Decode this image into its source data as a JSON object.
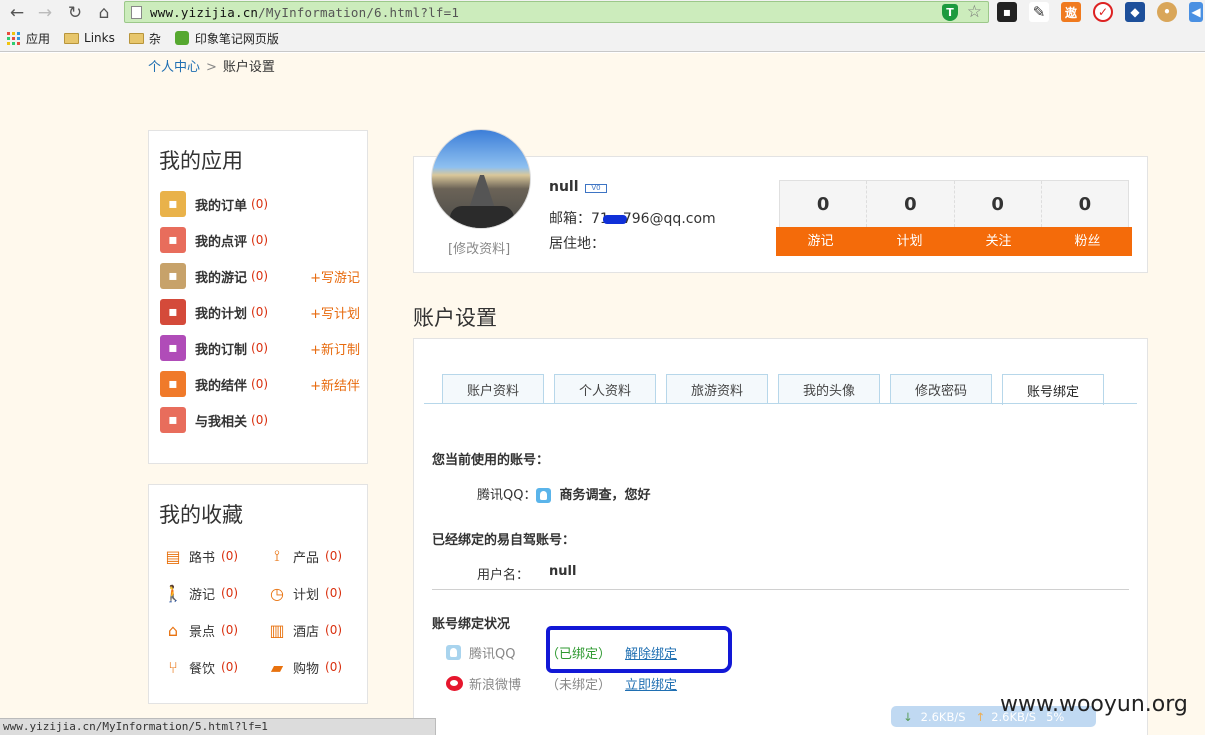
{
  "browser": {
    "url_host": "www.yizijia.cn",
    "url_path": "/MyInformation/6.html?lf=1",
    "bookmarks": [
      {
        "label": "应用"
      },
      {
        "label": "Links"
      },
      {
        "label": "杂"
      },
      {
        "label": "印象笔记网页版"
      }
    ],
    "status_url": "www.yizijia.cn/MyInformation/5.html?lf=1"
  },
  "breadcrumb": {
    "home": "个人中心",
    "sep": ">",
    "current": "账户设置"
  },
  "apps": {
    "title": "我的应用",
    "items": [
      {
        "label": "我的订单",
        "count": "(0)",
        "action": "",
        "icon": "order-icon",
        "color": "#e9b24a"
      },
      {
        "label": "我的点评",
        "count": "(0)",
        "action": "",
        "icon": "review-icon",
        "color": "#e86d5c"
      },
      {
        "label": "我的游记",
        "count": "(0)",
        "action": "+写游记",
        "icon": "travelnote-icon",
        "color": "#c7a26a"
      },
      {
        "label": "我的计划",
        "count": "(0)",
        "action": "+写计划",
        "icon": "clock-icon",
        "color": "#d44a3a"
      },
      {
        "label": "我的订制",
        "count": "(0)",
        "action": "+新订制",
        "icon": "custom-icon",
        "color": "#b04cb8"
      },
      {
        "label": "我的结伴",
        "count": "(0)",
        "action": "+新结伴",
        "icon": "group-icon",
        "color": "#f07a2a"
      },
      {
        "label": "与我相关",
        "count": "(0)",
        "action": "",
        "icon": "related-icon",
        "color": "#e86d5c"
      }
    ]
  },
  "favorites": {
    "title": "我的收藏",
    "items": [
      {
        "label": "路书",
        "count": "(0)",
        "icon": "roadbook-icon",
        "glyph": "▤"
      },
      {
        "label": "产品",
        "count": "(0)",
        "icon": "product-icon",
        "glyph": "⟟"
      },
      {
        "label": "游记",
        "count": "(0)",
        "icon": "walker-icon",
        "glyph": "🚶"
      },
      {
        "label": "计划",
        "count": "(0)",
        "icon": "clock-icon",
        "glyph": "◷"
      },
      {
        "label": "景点",
        "count": "(0)",
        "icon": "landmark-icon",
        "glyph": "⌂"
      },
      {
        "label": "酒店",
        "count": "(0)",
        "icon": "hotel-icon",
        "glyph": "▥"
      },
      {
        "label": "餐饮",
        "count": "(0)",
        "icon": "dining-icon",
        "glyph": "⑂"
      },
      {
        "label": "购物",
        "count": "(0)",
        "icon": "shopping-bag-icon",
        "glyph": "▰"
      }
    ]
  },
  "profile": {
    "edit": "[修改资料]",
    "name": "null",
    "badge": "V0",
    "email_prefix": "邮箱：71",
    "email_suffix": "796@qq.com",
    "home_label": "居住地：",
    "stats": [
      {
        "value": "0",
        "label": "游记"
      },
      {
        "value": "0",
        "label": "计划"
      },
      {
        "value": "0",
        "label": "关注"
      },
      {
        "value": "0",
        "label": "粉丝"
      }
    ]
  },
  "settings": {
    "title": "账户设置",
    "tabs": [
      "账户资料",
      "个人资料",
      "旅游资料",
      "我的头像",
      "修改密码",
      "账号绑定"
    ],
    "current_account_heading": "您当前使用的账号：",
    "qq_label": "腾讯QQ：",
    "qq_name": "商务调查，您好",
    "bound_heading": "已经绑定的易自驾账号：",
    "username_label": "用户名：",
    "username": "null",
    "status_heading": "账号绑定状况",
    "bindings": [
      {
        "service": "腾讯QQ",
        "status": "（已绑定）",
        "action": "解除绑定"
      },
      {
        "service": "新浪微博",
        "status": "（未绑定）",
        "action": "立即绑定"
      }
    ]
  },
  "overlay": {
    "down": "2.6KB/S",
    "up": "2.6KB/S",
    "pct": "5%",
    "watermark": "www.wooyun.org"
  }
}
